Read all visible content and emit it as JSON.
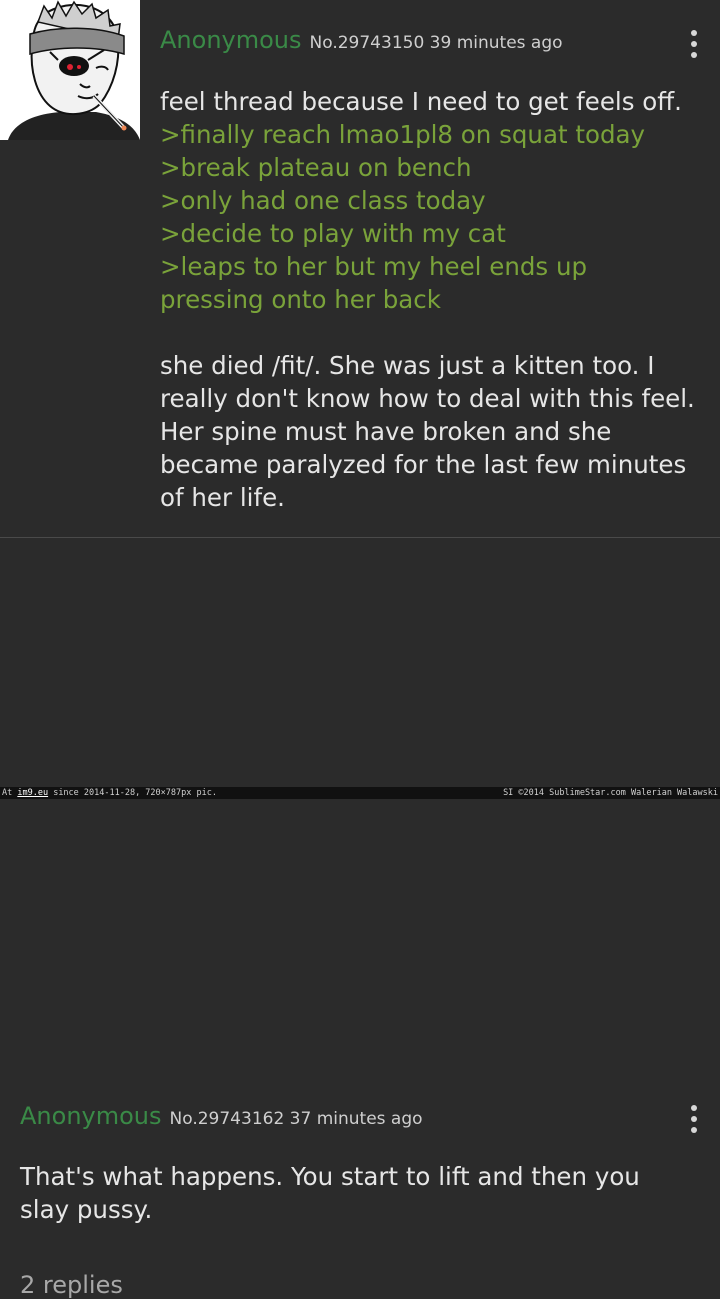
{
  "post1": {
    "avatar_icon": "feels-guy-avatar",
    "name": "Anonymous",
    "number": "No.29743150",
    "time": "39 minutes ago",
    "menu_icon": "more-vertical-icon",
    "lines": [
      {
        "text": "feel thread because I need to get feels off.",
        "style": "normal"
      },
      {
        "text": ">finally reach lmao1pl8 on squat today",
        "style": "greentext"
      },
      {
        "text": ">break plateau on bench",
        "style": "greentext"
      },
      {
        "text": ">only had one class today",
        "style": "greentext"
      },
      {
        "text": ">decide to play with my cat",
        "style": "greentext"
      },
      {
        "text": ">leaps to her but my heel ends up",
        "style": "greentext"
      },
      {
        "text": "pressing onto her back",
        "style": "greentext"
      },
      {
        "text": "",
        "style": "gap"
      },
      {
        "text": "she died /fit/. She was just a kitten too. I",
        "style": "normal"
      },
      {
        "text": "really don't know how to deal with this feel.",
        "style": "normal"
      },
      {
        "text": "Her spine must have broken and she",
        "style": "normal"
      },
      {
        "text": "became paralyzed for the last few minutes",
        "style": "normal"
      },
      {
        "text": "of her life.",
        "style": "normal"
      }
    ]
  },
  "post2": {
    "name": "Anonymous",
    "number": "No.29743162",
    "time": "37 minutes ago",
    "menu_icon": "more-vertical-icon",
    "lines": [
      {
        "text": "That's what happens. You start to lift and then you",
        "style": "normal"
      },
      {
        "text": "slay pussy.",
        "style": "normal"
      }
    ],
    "replies": "2 replies"
  },
  "watermark": {
    "left_prefix": "At ",
    "site": "im9.eu",
    "left_suffix": " since 2014-11-28, 720×787px pic.",
    "right": "SI ©2014 SublimeStar.com Walerian Walawski"
  },
  "colors": {
    "background": "#2b2b2b",
    "name": "#3a8a47",
    "greentext": "#7aa33a",
    "text": "#e6e6e6"
  }
}
